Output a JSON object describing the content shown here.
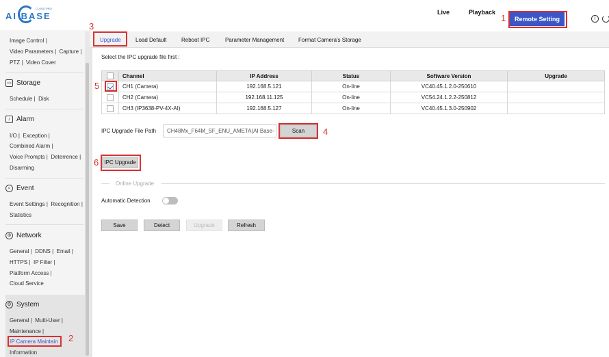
{
  "brand": {
    "logo_text": "AI BASE",
    "logo_sub": "CLOUD PRO"
  },
  "header": {
    "nav": [
      "Live",
      "Playback"
    ],
    "active_nav": "Remote Setting"
  },
  "annotations": [
    "1",
    "2",
    "3",
    "4",
    "5",
    "6"
  ],
  "sidebar": {
    "top_links": [
      "Image Control",
      "Video Parameters",
      "Capture",
      "PTZ",
      "Video Cover"
    ],
    "storage": {
      "title": "Storage",
      "links": [
        "Schedule",
        "Disk"
      ]
    },
    "alarm": {
      "title": "Alarm",
      "links": [
        "I/O",
        "Exception",
        "Combined Alarm",
        "Voice Prompts",
        "Deterrence",
        "Disarming"
      ]
    },
    "event": {
      "title": "Event",
      "links": [
        "Event Settings",
        "Recognition",
        "Statistics"
      ]
    },
    "network": {
      "title": "Network",
      "links": [
        "General",
        "DDNS",
        "Email",
        "HTTPS",
        "IP Filter",
        "Platform Access",
        "Cloud Service"
      ]
    },
    "system": {
      "title": "System",
      "links": [
        "General",
        "Multi-User",
        "Maintenance",
        "IP Camera Maintain",
        "Information"
      ]
    }
  },
  "tabs": [
    "Upgrade",
    "Load Default",
    "Reboot IPC",
    "Parameter Management",
    "Format Camera's Storage"
  ],
  "main": {
    "instruction": "Select the IPC upgrade file first :",
    "table": {
      "headers": [
        "Channel",
        "IP Address",
        "Status",
        "Software Version",
        "Upgrade"
      ],
      "rows": [
        {
          "checked": true,
          "channel": "CH1 (Camera)",
          "ip": "192.168.5.121",
          "status": "On-line",
          "version": "VC40.45.1.2.0-250610",
          "upgrade": ""
        },
        {
          "checked": false,
          "channel": "CH2 (Camera)",
          "ip": "192.168.11.125",
          "status": "On-line",
          "version": "VC54.24.1.2.2-250812",
          "upgrade": ""
        },
        {
          "checked": false,
          "channel": "CH3 (IP3638-PV-4X-AI)",
          "ip": "192.168.5.127",
          "status": "On-line",
          "version": "VC40.45.1.3.0-250902",
          "upgrade": ""
        }
      ]
    },
    "file_path_label": "IPC Upgrade File Path",
    "file_path_value": "CH48Mx_F64M_SF_ENU_AMETA(AI Base-",
    "scan_label": "Scan",
    "ipc_upgrade_label": "IPC Upgrade",
    "online_upgrade_label": "Online Upgrade",
    "auto_detect_label": "Automatic Detection",
    "auto_detect_on": false,
    "buttons": {
      "save": "Save",
      "detect": "Detect",
      "upgrade": "Upgrade",
      "refresh": "Refresh"
    }
  },
  "colors": {
    "accent": "#3b56c8",
    "highlight_box": "#d93030"
  }
}
